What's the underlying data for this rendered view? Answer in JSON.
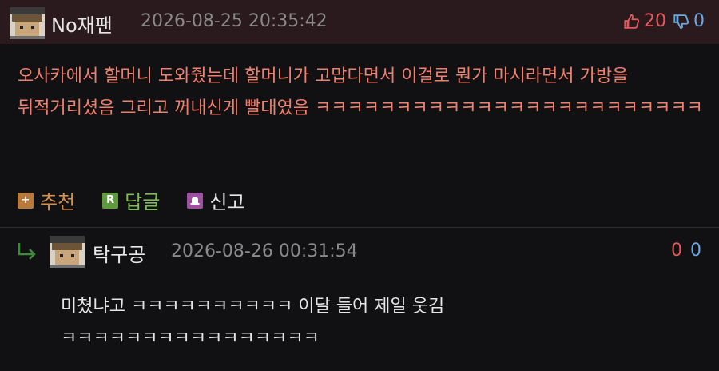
{
  "post": {
    "username": "No재팬",
    "timestamp": "2026-08-25 20:35:42",
    "upvotes": "20",
    "downvotes": "0",
    "body": "오사카에서 할머니 도와줬는데 할머니가 고맙다면서 이걸로 뭔가 마시라면서 가방을 뒤적거리셨음 그리고 꺼내신게 빨대였음 ㅋㅋㅋㅋㅋㅋㅋㅋㅋㅋㅋㅋㅋㅋㅋㅋㅋㅋㅋㅋㅋㅋㅋㅋ",
    "actions": {
      "recommend_label": "추천",
      "reply_label": "답글",
      "report_label": "신고",
      "recommend_icon": "+",
      "reply_icon": "R"
    }
  },
  "comment": {
    "username": "탁구공",
    "timestamp": "2026-08-26 00:31:54",
    "upvotes": "0",
    "downvotes": "0",
    "body": "미쳤냐고 ㅋㅋㅋㅋㅋㅋㅋㅋㅋㅋ 이달 들어 제일 웃김 ㅋㅋㅋㅋㅋㅋㅋㅋㅋㅋㅋㅋㅋㅋㅋㅋ"
  },
  "colors": {
    "background": "#111113",
    "header_background": "#2b1a1d",
    "post_text": "#f07f6c",
    "upvote": "#e2585d",
    "downvote": "#6aa8e0"
  },
  "icons": [
    "avatar-pixel-icon",
    "thumbs-up-icon",
    "thumbs-down-icon",
    "plus-icon",
    "reply-r-icon",
    "report-bell-icon",
    "reply-arrow-icon"
  ]
}
